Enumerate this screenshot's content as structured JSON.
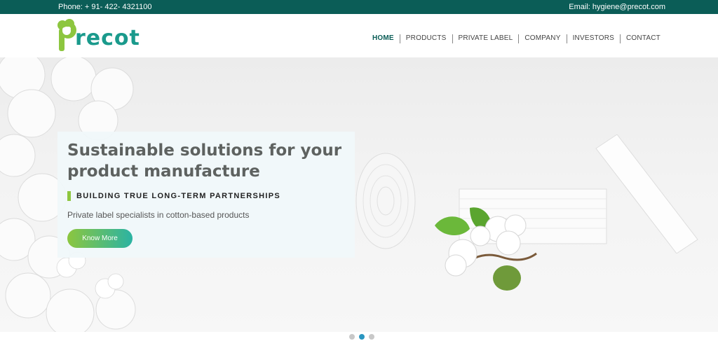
{
  "topbar": {
    "phone": "Phone: + 91- 422- 4321100",
    "email": "Email: hygiene@precot.com"
  },
  "logo": {
    "text": "recot",
    "icon": "cotton-p-logo-icon"
  },
  "nav": {
    "items": [
      {
        "label": "HOME",
        "active": true
      },
      {
        "label": "PRODUCTS"
      },
      {
        "label": "PRIVATE LABEL"
      },
      {
        "label": "COMPANY"
      },
      {
        "label": "INVESTORS"
      },
      {
        "label": "CONTACT"
      }
    ]
  },
  "hero": {
    "title": "Sustainable solutions for your product manufacture",
    "subtitle": "BUILDING TRUE LONG-TERM PARTNERSHIPS",
    "description": "Private label specialists in cotton-based products",
    "button_label": "Know More"
  },
  "carousel": {
    "slide_count": 3,
    "active_index": 1
  },
  "colors": {
    "topbar": "#0b5d57",
    "nav_active": "#0b5d57",
    "accent_green": "#8dc63f",
    "accent_teal": "#2bb3a3",
    "dot_active": "#2a96c0"
  }
}
